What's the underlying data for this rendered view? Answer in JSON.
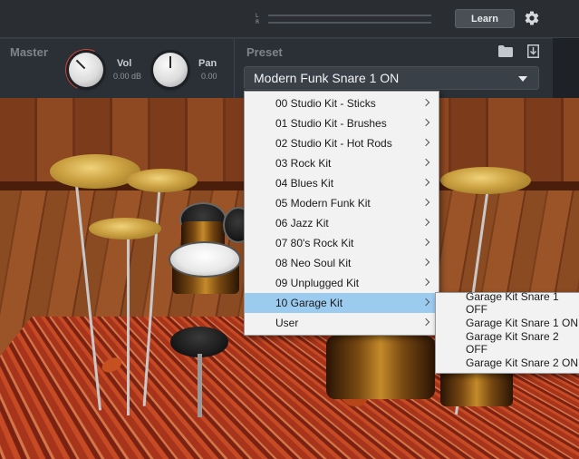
{
  "topbar": {
    "meter_labels": [
      "L",
      "R"
    ],
    "learn_label": "Learn"
  },
  "master": {
    "title": "Master",
    "vol": {
      "label": "Vol",
      "value": "0.00 dB"
    },
    "pan": {
      "label": "Pan",
      "value": "0.00"
    }
  },
  "preset": {
    "title": "Preset",
    "selected": "Modern Funk Snare 1 ON"
  },
  "kit_menu": {
    "items": [
      {
        "label": "00 Studio Kit - Sticks",
        "has_submenu": true
      },
      {
        "label": "01 Studio Kit - Brushes",
        "has_submenu": true
      },
      {
        "label": "02 Studio Kit - Hot Rods",
        "has_submenu": true
      },
      {
        "label": "03 Rock Kit",
        "has_submenu": true
      },
      {
        "label": "04 Blues Kit",
        "has_submenu": true
      },
      {
        "label": "05 Modern Funk Kit",
        "has_submenu": true
      },
      {
        "label": "06 Jazz Kit",
        "has_submenu": true
      },
      {
        "label": "07 80's Rock Kit",
        "has_submenu": true
      },
      {
        "label": "08 Neo Soul Kit",
        "has_submenu": true
      },
      {
        "label": "09 Unplugged Kit",
        "has_submenu": true
      },
      {
        "label": "10 Garage Kit",
        "has_submenu": true,
        "active": true
      },
      {
        "label": "User",
        "has_submenu": true
      }
    ]
  },
  "snare_menu": {
    "items": [
      {
        "label": "Garage Kit Snare 1 OFF"
      },
      {
        "label": "Garage Kit Snare 1 ON"
      },
      {
        "label": "Garage Kit Snare 2 OFF"
      },
      {
        "label": "Garage Kit Snare 2 ON"
      }
    ]
  },
  "colors": {
    "accent_ring": "#d0463a",
    "menu_highlight": "#9ccbf0",
    "panel_bg": "#2b3036"
  },
  "icons": {
    "settings": "gear-icon",
    "folder": "folder-icon",
    "save": "save-icon",
    "dropdown": "caret-down-icon",
    "submenu": "chevron-right-icon"
  }
}
